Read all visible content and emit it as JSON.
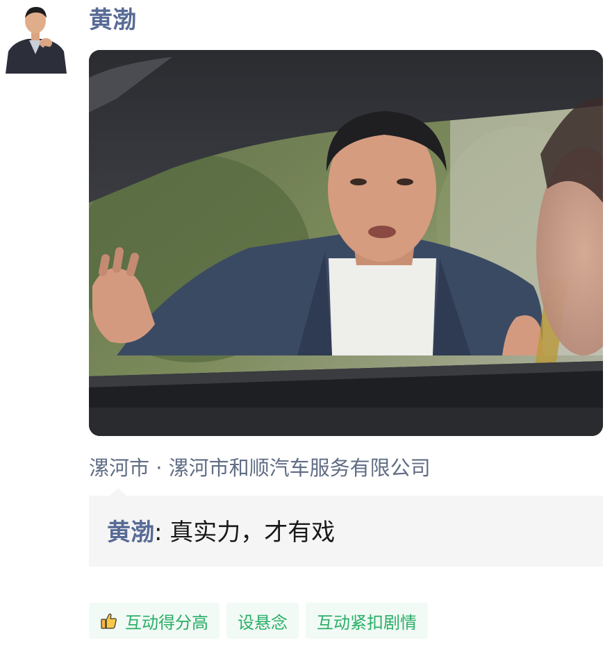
{
  "post": {
    "author_name": "黄渤",
    "location": "漯河市 · 漯河市和顺汽车服务有限公司",
    "comment": {
      "author": "黄渤",
      "separator": ":",
      "text": " 真实力，才有戏"
    },
    "tags": [
      {
        "label": "互动得分高",
        "icon": "thumbs-up-icon"
      },
      {
        "label": "设悬念"
      },
      {
        "label": "互动紧扣剧情"
      }
    ]
  },
  "colors": {
    "name_blue": "#576b95",
    "location_gray": "#5f6c84",
    "tag_green": "#2aae67",
    "tag_bg": "#f1faf5",
    "comment_bg": "#f5f5f5"
  }
}
